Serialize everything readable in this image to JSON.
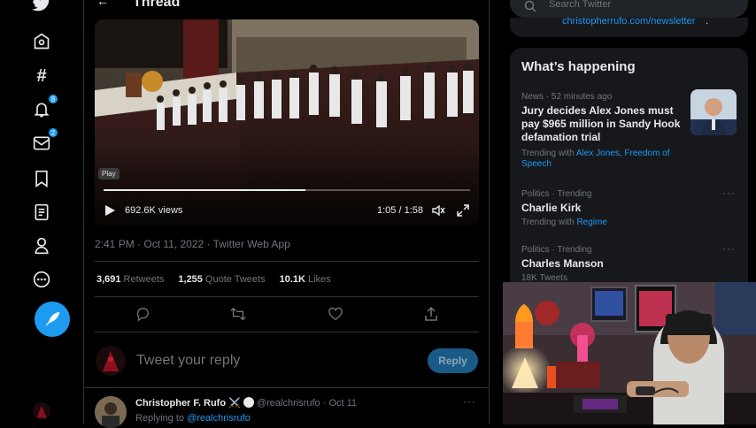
{
  "nav": {
    "notifications_badge": "8",
    "messages_badge": "2"
  },
  "thread": {
    "title": "Thread",
    "video": {
      "play_tooltip": "Play",
      "views": "692.6K views",
      "time": "1:05 / 1:58",
      "progress": 0.55
    },
    "timestamp": "2:41 PM · Oct 11, 2022 · Twitter Web App",
    "stats": [
      {
        "value": "3,691",
        "label": "Retweets"
      },
      {
        "value": "1,255",
        "label": "Quote Tweets"
      },
      {
        "value": "10.1K",
        "label": "Likes"
      }
    ],
    "reply_placeholder": "Tweet your reply",
    "reply_button": "Reply",
    "next_tweet": {
      "name": "Christopher F. Rufo",
      "emoji": "⚔️",
      "handle": "@realchrisrufo",
      "dot": "·",
      "date": "Oct 11",
      "replying_to_label": "Replying to",
      "replying_to_handle": "@realchrisrufo"
    }
  },
  "sidebar": {
    "search_placeholder": "Search Twitter",
    "newsletter_link": "christopherrufo.com/newsletter",
    "newsletter_tail": ".",
    "whats_happening": "What’s happening",
    "trends": [
      {
        "meta": "News · 52 minutes ago",
        "title": "Jury decides Alex Jones must pay $965 million in Sandy Hook defamation trial",
        "sub_prefix": "Trending with",
        "sub_link": "Alex Jones, Freedom of Speech"
      },
      {
        "meta": "Politics · Trending",
        "title": "Charlie Kirk",
        "sub_prefix": "Trending with",
        "sub_link": "Regime"
      },
      {
        "meta": "Politics · Trending",
        "title": "Charles Manson",
        "sub_prefix": "18K Tweets",
        "sub_link": ""
      }
    ]
  },
  "colors": {
    "accent": "#1d9bf0",
    "background": "#000000",
    "panel": "#16181c"
  }
}
